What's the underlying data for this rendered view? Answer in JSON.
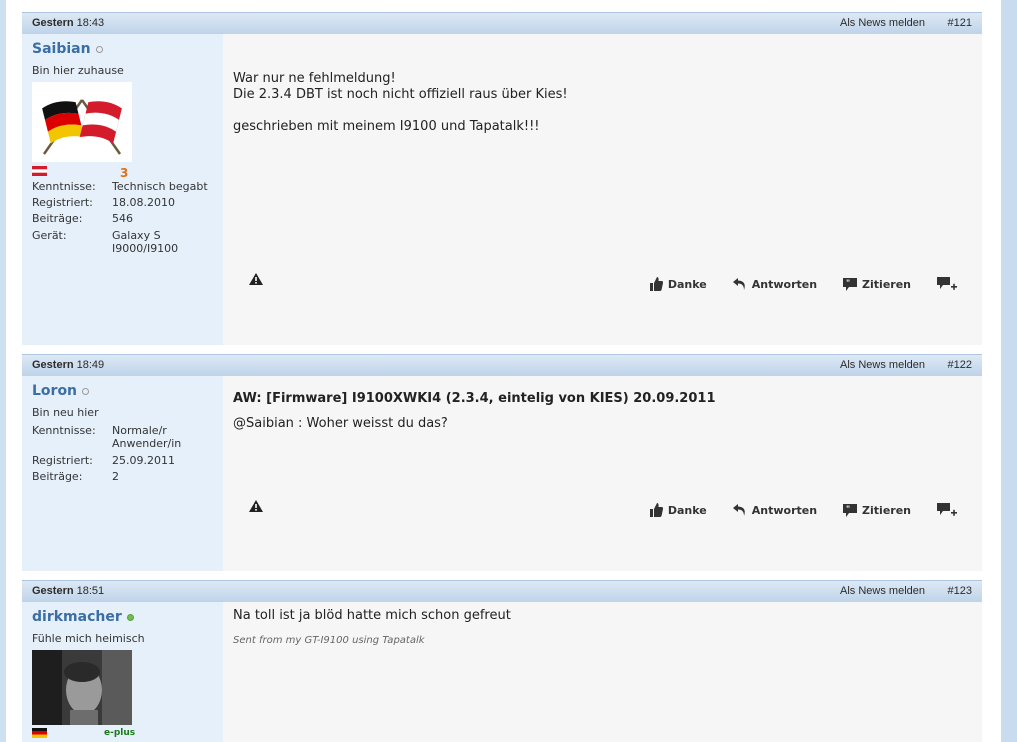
{
  "posts": [
    {
      "date_label": "Gestern",
      "time": "18:43",
      "report_label": "Als News melden",
      "number": "#121",
      "username": "Saibian",
      "online": false,
      "rank": "Bin hier zuhause",
      "avatar": "flags-germany-austria",
      "icon_badge": "3",
      "fields": [
        {
          "label": "Kenntnisse:",
          "value": "Technisch begabt"
        },
        {
          "label": "Registriert:",
          "value": "18.08.2010"
        },
        {
          "label": "Beiträge:",
          "value": "546"
        },
        {
          "label": "Gerät:",
          "value": "Galaxy S I9000/I9100"
        }
      ],
      "title": "",
      "message": "War nur ne fehlmeldung!\nDie 2.3.4 DBT ist noch nicht offiziell raus über Kies!\n\ngeschrieben mit meinem I9100 und Tapatalk!!!",
      "signature": ""
    },
    {
      "date_label": "Gestern",
      "time": "18:49",
      "report_label": "Als News melden",
      "number": "#122",
      "username": "Loron",
      "online": false,
      "rank": "Bin neu hier",
      "fields": [
        {
          "label": "Kenntnisse:",
          "value": "Normale/r Anwender/in"
        },
        {
          "label": "Registriert:",
          "value": "25.09.2011"
        },
        {
          "label": "Beiträge:",
          "value": "2"
        }
      ],
      "title": "AW: [Firmware] I9100XWKI4 (2.3.4, eintelig von KIES) 20.09.2011",
      "message": "@Saibian : Woher weisst du das?",
      "signature": ""
    },
    {
      "date_label": "Gestern",
      "time": "18:51",
      "report_label": "Als News melden",
      "number": "#123",
      "username": "dirkmacher",
      "online": true,
      "rank": "Fühle mich heimisch",
      "avatar": "portrait-photo",
      "icon_badge": "e-plus",
      "title": "",
      "message": "Na toll ist ja blöd hatte mich schon gefreut",
      "signature": "Sent from my GT-I9100 using Tapatalk"
    }
  ],
  "actions": {
    "thanks": "Danke",
    "reply": "Antworten",
    "quote": "Zitieren"
  },
  "icons": {
    "warn": "warning-icon",
    "thanks": "thumbs-up-icon",
    "reply": "reply-arrow-icon",
    "quote": "quote-bubble-icon",
    "multiquote": "multiquote-plus-icon"
  },
  "colors": {
    "username": "#3a6ea5",
    "header_bg": "#c9dcef",
    "userinfo_bg": "#e6f0fb",
    "body_bg": "#f6f6f6"
  }
}
